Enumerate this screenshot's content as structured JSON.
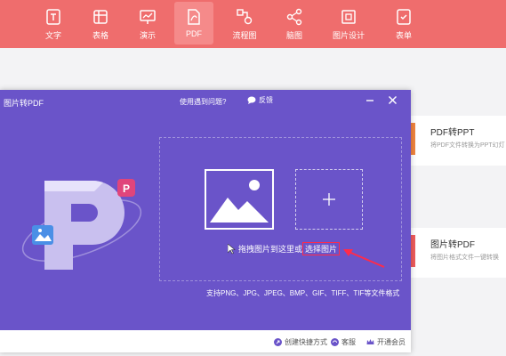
{
  "nav": {
    "items": [
      {
        "label": "文字",
        "icon": "text-doc-icon"
      },
      {
        "label": "表格",
        "icon": "table-icon"
      },
      {
        "label": "演示",
        "icon": "presentation-icon"
      },
      {
        "label": "PDF",
        "icon": "pdf-icon"
      },
      {
        "label": "流程图",
        "icon": "flowchart-icon"
      },
      {
        "label": "脑图",
        "icon": "mindmap-icon"
      },
      {
        "label": "图片设计",
        "icon": "image-design-icon"
      },
      {
        "label": "表单",
        "icon": "form-icon"
      }
    ],
    "active_index": 3
  },
  "side_cards": [
    {
      "title": "PDF转PPT",
      "desc": "将PDF文件转换为PPT幻灯",
      "accent": "#f0843f"
    },
    {
      "title": "图片转PDF",
      "desc": "将图片格式文件一键转换",
      "accent": "#ee5b5b"
    }
  ],
  "dialog": {
    "title": "图片转PDF",
    "help": "使用遇到问题?",
    "feedback": "反馈",
    "drop_hint": "拖拽图片到这里或",
    "choose_link": "选择图片",
    "formats": "支持PNG、JPG、JPEG、BMP、GIF、TIFF、TIF等文件格式",
    "footer": {
      "shortcut": "创建快捷方式",
      "service": "客服",
      "vip": "开通会员"
    }
  },
  "colors": {
    "topbar": "#ef6d6d",
    "dialog_bg": "#6a54c9",
    "highlight": "#ff2b4a"
  }
}
